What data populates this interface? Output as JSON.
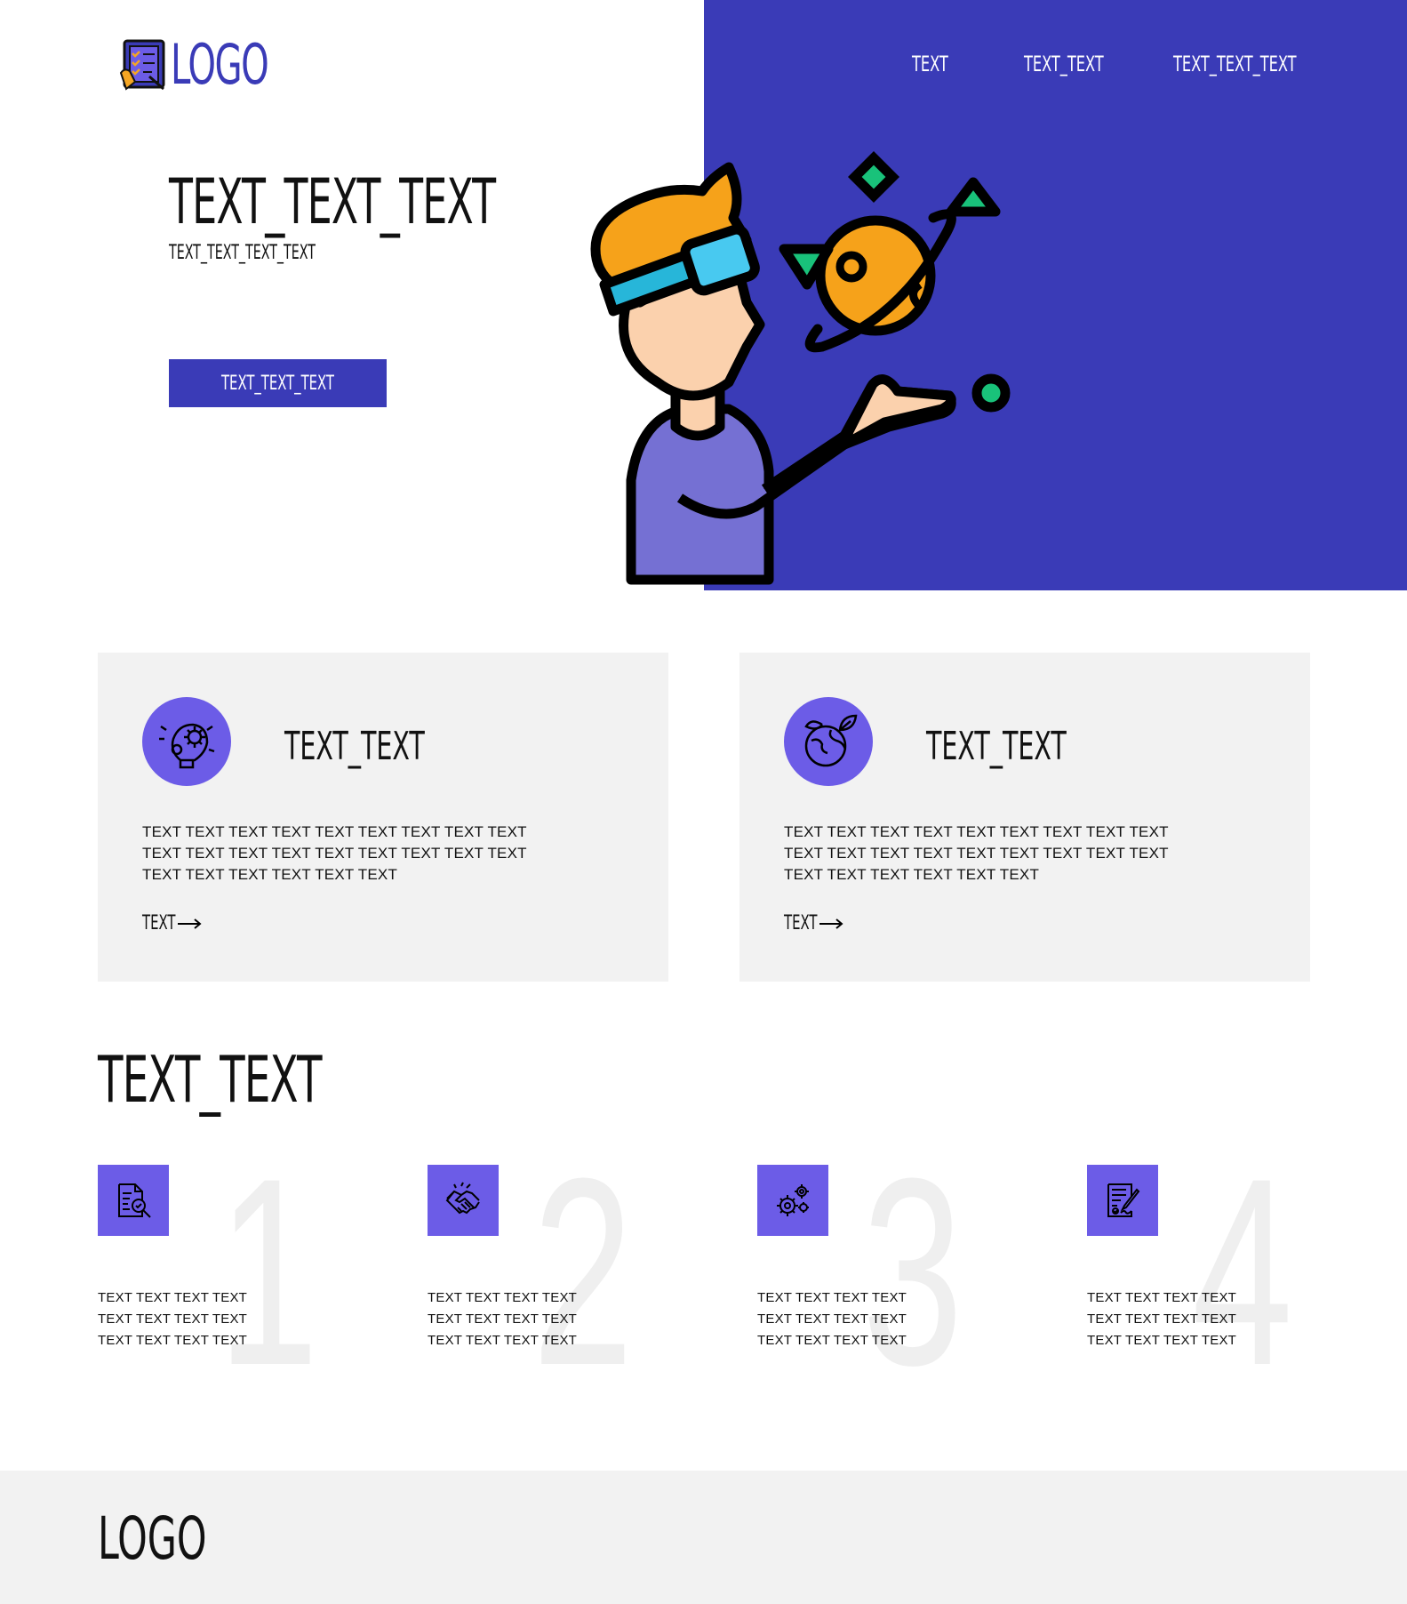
{
  "header": {
    "logo_text": "LOGO",
    "nav": [
      "TEXT",
      "TEXT_TEXT",
      "TEXT_TEXT_TEXT"
    ]
  },
  "hero": {
    "title": "TEXT_TEXT_TEXT",
    "subtitle": "TEXT_TEXT_TEXT_TEXT",
    "button_label": "TEXT_TEXT_TEXT",
    "accent_color": "#3a3bb7"
  },
  "cards": [
    {
      "icon": "idea-gear-icon",
      "title": "TEXT_TEXT",
      "body": "TEXT TEXT TEXT TEXT TEXT TEXT TEXT TEXT TEXT TEXT TEXT TEXT TEXT TEXT TEXT TEXT TEXT TEXT TEXT TEXT TEXT TEXT TEXT TEXT",
      "link_label": "TEXT"
    },
    {
      "icon": "globe-leaf-icon",
      "title": "TEXT_TEXT",
      "body": "TEXT TEXT TEXT TEXT TEXT TEXT TEXT TEXT TEXT TEXT TEXT TEXT TEXT TEXT TEXT TEXT TEXT TEXT TEXT TEXT TEXT TEXT TEXT TEXT",
      "link_label": "TEXT"
    }
  ],
  "steps_section": {
    "title": "TEXT_TEXT",
    "steps": [
      {
        "number": "1",
        "icon": "document-search-icon",
        "text": "TEXT TEXT TEXT TEXT TEXT TEXT TEXT TEXT TEXT TEXT TEXT TEXT"
      },
      {
        "number": "2",
        "icon": "handshake-icon",
        "text": "TEXT TEXT TEXT TEXT TEXT TEXT TEXT TEXT TEXT TEXT TEXT TEXT"
      },
      {
        "number": "3",
        "icon": "gears-icon",
        "text": "TEXT TEXT TEXT TEXT TEXT TEXT TEXT TEXT TEXT TEXT TEXT TEXT"
      },
      {
        "number": "4",
        "icon": "contract-sign-icon",
        "text": "TEXT TEXT TEXT TEXT TEXT TEXT TEXT TEXT TEXT TEXT TEXT TEXT"
      }
    ]
  },
  "footer": {
    "logo_text": "LOGO"
  },
  "colors": {
    "primary": "#3a3bb7",
    "icon_bg": "#6c5ce7",
    "panel": "#f2f2f2"
  }
}
